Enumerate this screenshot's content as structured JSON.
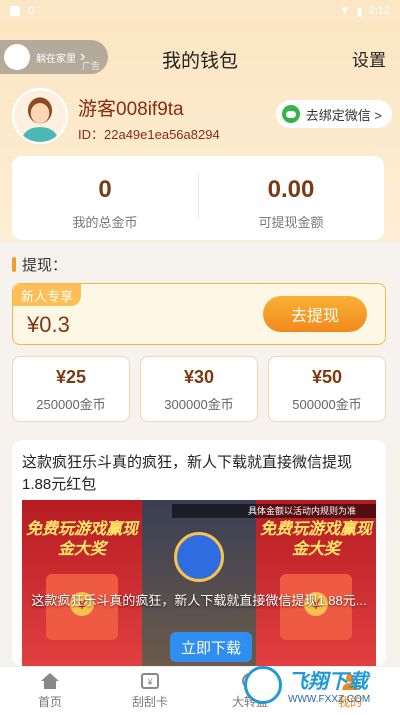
{
  "status_bar": {
    "left": "0",
    "time": "2:12"
  },
  "ad_pill": {
    "text": "躺在家里",
    "tag": "广告"
  },
  "nav": {
    "title": "我的钱包",
    "settings": "设置"
  },
  "profile": {
    "username": "游客008if9ta",
    "user_id": "ID：22a49e1ea56a8294",
    "wechat_bind": "去绑定微信 >"
  },
  "balance": {
    "coins_value": "0",
    "coins_label": "我的总金币",
    "cash_value": "0.00",
    "cash_label": "可提现金额"
  },
  "withdraw": {
    "title": "提现：",
    "newuser_tag": "新人专享",
    "newuser_amount": "¥0.3",
    "button": "去提现",
    "options": [
      {
        "price": "¥25",
        "coins": "250000金币"
      },
      {
        "price": "¥30",
        "coins": "300000金币"
      },
      {
        "price": "¥50",
        "coins": "500000金币"
      }
    ]
  },
  "ad": {
    "title": "这款疯狂乐斗真的疯狂，新人下载就直接微信提现1.88元红包",
    "game_text_left": "免费玩游戏赢现金大奖",
    "game_text_right": "免费玩游戏赢现金大奖",
    "strip_text": "具体金额以活动内规则为准",
    "overlay_text": "这款疯狂乐斗真的疯狂，新人下载就直接微信提现1.88元...",
    "download_button": "立即下载"
  },
  "tabs": [
    {
      "label": "首页",
      "icon": "home-icon"
    },
    {
      "label": "刮刮卡",
      "icon": "scratch-card-icon"
    },
    {
      "label": "大转盘",
      "icon": "wheel-icon"
    },
    {
      "label": "我的",
      "icon": "user-icon"
    }
  ],
  "watermark": {
    "title": "飞翔下载",
    "sub": "WWW.FXXZ.COM"
  },
  "colors": {
    "accent": "#f0891c",
    "brown_text": "#7a3a12",
    "header_bg": "#fce6c2",
    "wechat_green": "#34b34a"
  }
}
